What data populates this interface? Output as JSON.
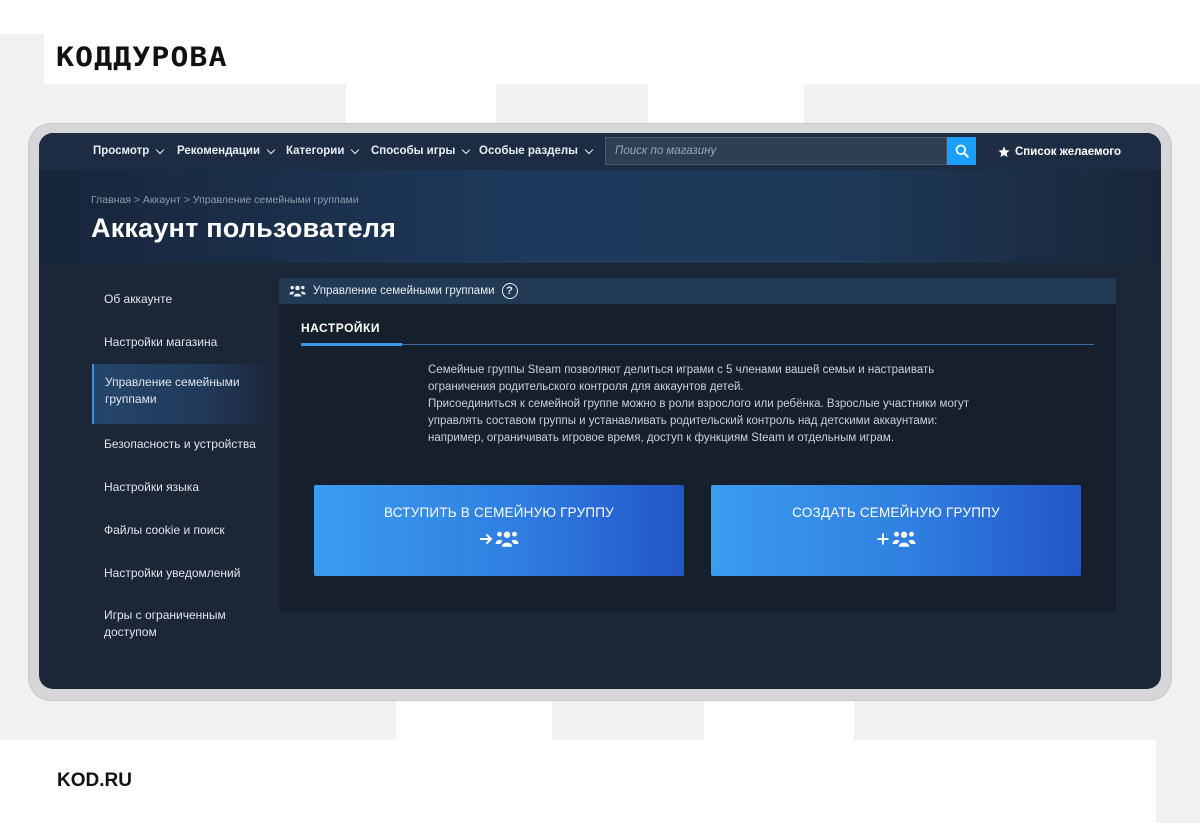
{
  "brand": {
    "logo": "КОДДУРОВА",
    "footer": "KOD.RU"
  },
  "nav": {
    "items": [
      {
        "label": "Просмотр"
      },
      {
        "label": "Рекомендации"
      },
      {
        "label": "Категории"
      },
      {
        "label": "Способы игры"
      },
      {
        "label": "Особые разделы"
      }
    ],
    "search_placeholder": "Поиск по магазину",
    "wishlist_label": "Список желаемого"
  },
  "header": {
    "breadcrumb": "Главная > Аккаунт > Управление семейными группами",
    "title": "Аккаунт пользователя"
  },
  "sidebar": {
    "items": [
      {
        "label": "Об аккаунте"
      },
      {
        "label": "Настройки магазина"
      },
      {
        "label": "Управление семейными группами",
        "active": true
      },
      {
        "label": "Безопасность и устройства"
      },
      {
        "label": "Настройки языка"
      },
      {
        "label": "Файлы cookie и поиск"
      },
      {
        "label": "Настройки уведомлений"
      },
      {
        "label": "Игры с ограниченным доступом"
      }
    ]
  },
  "panel": {
    "title": "Управление семейными группами",
    "help": "?",
    "tab": "НАСТРОЙКИ",
    "description_1": "Семейные группы Steam позволяют делиться играми с 5 членами вашей семьи и настраивать ограничения родительского контроля для аккаунтов детей.",
    "description_2": "Присоединиться к семейной группе можно в роли взрослого или ребёнка. Взрослые участники могут управлять составом группы и устанавливать родительский контроль над детскими аккаунтами: например, ограничивать игровое время, доступ к функциям Steam и отдельным играм.",
    "join_label": "ВСТУПИТЬ В СЕМЕЙНУЮ ГРУППУ",
    "create_label": "СОЗДАТЬ СЕМЕЙНУЮ ГРУППУ"
  },
  "colors": {
    "accent": "#1a9fff",
    "window_bg": "#1b2636",
    "nav_bg": "#1d2c42",
    "button_gradient_start": "#3b9cf0",
    "button_gradient_end": "#2356c8"
  },
  "icons": [
    "search-icon",
    "star-icon",
    "family-icon",
    "help-icon",
    "arrow-right-icon",
    "plus-icon"
  ]
}
